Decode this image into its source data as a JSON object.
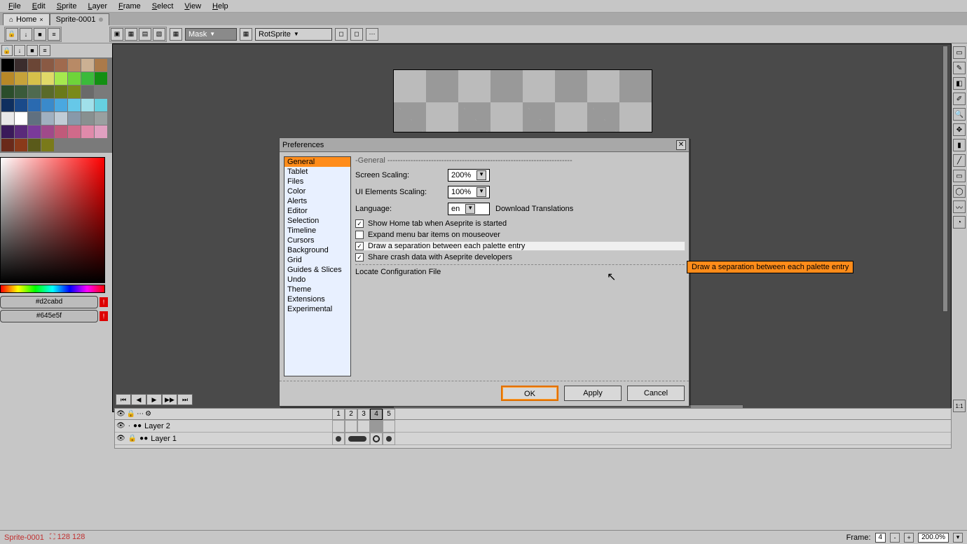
{
  "menu": {
    "items": [
      "File",
      "Edit",
      "Sprite",
      "Layer",
      "Frame",
      "Select",
      "View",
      "Help"
    ]
  },
  "tabs": {
    "home": "Home",
    "sprite": "Sprite-0001"
  },
  "toolbar": {
    "mask": "Mask",
    "rotsprite": "RotSprite"
  },
  "palette": [
    "#000000",
    "#3b2d2d",
    "#6b4636",
    "#8a5a44",
    "#a06a4e",
    "#b88a66",
    "#cbb093",
    "#ab7a4a",
    "#b88827",
    "#c6a23a",
    "#d6c04a",
    "#e0d968",
    "#a6e84e",
    "#6ed43a",
    "#3bba3b",
    "#138f13",
    "#2b4d2b",
    "#3a5a3a",
    "#4f6a4f",
    "#5a6a2a",
    "#6a7a1a",
    "#7a8a1a",
    "#6a6a6a",
    "#7a7a7a",
    "#0f2f5f",
    "#1a4a8a",
    "#2a6ab0",
    "#3a8acb",
    "#4aa8e0",
    "#66c8e8",
    "#a0e0ea",
    "#66d0e0",
    "#e8e8e8",
    "#ffffff",
    "#607080",
    "#a0b0c0",
    "#c0ccd6",
    "#8899aa",
    "#889090",
    "#9aa0a0",
    "#3a1a5a",
    "#5a2a7a",
    "#7a3a9a",
    "#a04a8a",
    "#c05a7a",
    "#d06a8a",
    "#e08aaa",
    "#e0a0c0",
    "#6a2a1a",
    "#8a3a1a",
    "#5a5a1a",
    "#7a7a1a",
    "",
    "",
    "",
    ""
  ],
  "fg_color": "#d2cabd",
  "bg_color": "#645e5f",
  "dialog": {
    "title": "Preferences",
    "categories": [
      "General",
      "Tablet",
      "Files",
      "Color",
      "Alerts",
      "Editor",
      "Selection",
      "Timeline",
      "Cursors",
      "Background",
      "Grid",
      "Guides & Slices",
      "Undo",
      "Theme",
      "Extensions",
      "Experimental"
    ],
    "section": "General",
    "screen_scaling_label": "Screen Scaling:",
    "screen_scaling": "200%",
    "ui_scaling_label": "UI Elements Scaling:",
    "ui_scaling": "100%",
    "language_label": "Language:",
    "language": "en",
    "download_translations": "Download Translations",
    "chk_home": "Show Home tab when Aseprite is started",
    "chk_expand": "Expand menu bar items on mouseover",
    "chk_palette_sep": "Draw a separation between each palette entry",
    "chk_crash": "Share crash data with Aseprite developers",
    "locate": "Locate Configuration File",
    "ok": "OK",
    "apply": "Apply",
    "cancel": "Cancel"
  },
  "tooltip": "Draw a separation between each palette entry",
  "timeline": {
    "frames": [
      "1",
      "2",
      "3",
      "4",
      "5"
    ],
    "active_frame": 4,
    "layers": [
      "Layer 2",
      "Layer 1"
    ]
  },
  "status": {
    "sprite": "Sprite-0001",
    "dims": "128 128",
    "frame_label": "Frame:",
    "frame": "4",
    "zoom": "200.0%"
  }
}
